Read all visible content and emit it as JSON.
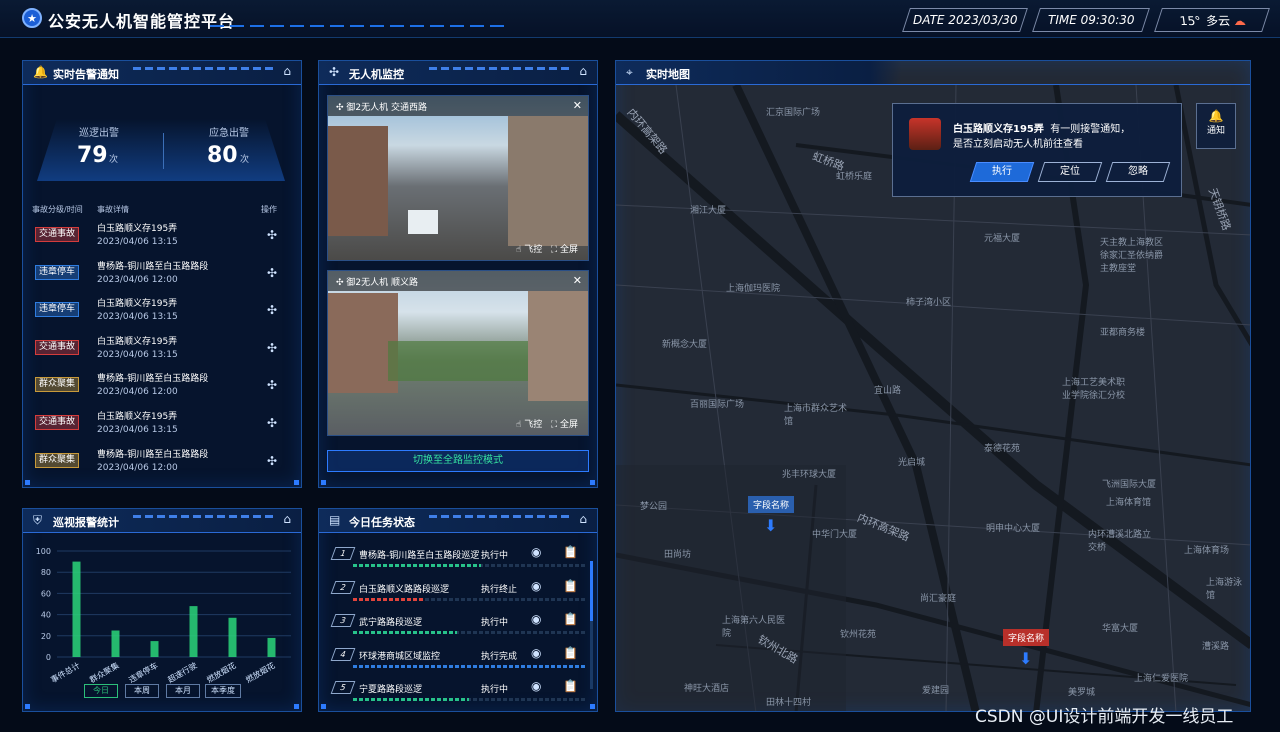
{
  "app": {
    "title": "公安无人机智能管控平台"
  },
  "header": {
    "date": "DATE 2023/03/30",
    "time": "TIME  09:30:30",
    "weather": "15° 多云"
  },
  "alarm_panel": {
    "title": "实时告警通知",
    "patrol_label": "巡逻出警",
    "patrol_count": "79",
    "emergency_label": "应急出警",
    "emergency_count": "80",
    "unit": "次",
    "col_type_time": "事故分级/时间",
    "col_detail": "事故详情",
    "col_action": "操作",
    "rows": [
      {
        "tag": "交通事故",
        "color": "#d43c3c",
        "detail": "白玉路顺义存195弄",
        "time": "2023/04/06 13:15"
      },
      {
        "tag": "违章停车",
        "color": "#2f7de0",
        "detail": "曹杨路-铜川路至白玉路路段",
        "time": "2023/04/06 12:00"
      },
      {
        "tag": "违章停车",
        "color": "#2f7de0",
        "detail": "白玉路顺义存195弄",
        "time": "2023/04/06 13:15"
      },
      {
        "tag": "交通事故",
        "color": "#d43c3c",
        "detail": "白玉路顺义存195弄",
        "time": "2023/04/06 13:15"
      },
      {
        "tag": "群众聚集",
        "color": "#c89a3a",
        "detail": "曹杨路-铜川路至白玉路路段",
        "time": "2023/04/06 12:00"
      },
      {
        "tag": "交通事故",
        "color": "#d43c3c",
        "detail": "白玉路顺义存195弄",
        "time": "2023/04/06 13:15"
      },
      {
        "tag": "群众聚集",
        "color": "#c89a3a",
        "detail": "曹杨路-铜川路至白玉路路段",
        "time": "2023/04/06 12:00"
      }
    ]
  },
  "drone_panel": {
    "title": "无人机监控",
    "cam1": {
      "label": "御2无人机  交通西路",
      "fly": "飞控",
      "full": "全屏"
    },
    "cam2": {
      "label": "御2无人机  顺义路",
      "fly": "飞控",
      "full": "全屏"
    },
    "switch_btn": "切换至全路监控模式"
  },
  "stats_panel": {
    "title": "巡视报警统计",
    "tabs": [
      "今日",
      "本周",
      "本月",
      "本季度"
    ]
  },
  "chart_data": {
    "type": "bar",
    "categories": [
      "事件总计",
      "群众聚集",
      "违章停车",
      "超速行驶",
      "燃放烟花",
      "燃放烟花"
    ],
    "values": [
      90,
      25,
      15,
      48,
      37,
      18
    ],
    "ylim": [
      0,
      100
    ],
    "yticks": [
      "0",
      "20",
      "40",
      "60",
      "80",
      "100"
    ]
  },
  "task_panel": {
    "title": "今日任务状态",
    "tasks": [
      {
        "num": "1",
        "name": "曹杨路-铜川路至白玉路段巡逻",
        "status": "执行中",
        "progress": 0.55,
        "color": "#27c28a"
      },
      {
        "num": "2",
        "name": "白玉路顺义路路段巡逻",
        "status": "执行终止",
        "progress": 0.3,
        "color": "#e0443c"
      },
      {
        "num": "3",
        "name": "武宁路路段巡逻",
        "status": "执行中",
        "progress": 0.45,
        "color": "#27c28a"
      },
      {
        "num": "4",
        "name": "环球港商城区域监控",
        "status": "执行完成",
        "progress": 1.0,
        "color": "#2f7de0"
      },
      {
        "num": "5",
        "name": "宁夏路路段巡逻",
        "status": "执行中",
        "progress": 0.5,
        "color": "#27c28a"
      }
    ]
  },
  "map_panel": {
    "title": "实时地图",
    "notify_label": "通知",
    "popup": {
      "place": "白玉路顺义存195弄",
      "msg1": "有一则接警通知，",
      "msg2": "是否立刻启动无人机前往查看",
      "execute": "执行",
      "locate": "定位",
      "ignore": "忽略"
    },
    "pin1": "字段名称",
    "pin2": "字段名称",
    "places": [
      "汇京国际广场",
      "虹桥乐庭",
      "湘江大厦",
      "上海伽玛医院",
      "新概念大厦",
      "百丽国际广场",
      "上海市群众艺术馆",
      "兆丰环球大厦",
      "光启城",
      "梦公园",
      "田尚坊",
      "中华门大厦",
      "上海第六人民医院",
      "钦州花苑",
      "尚汇豪庭",
      "神旺大酒店",
      "田林十四村",
      "爱建园",
      "元福大厦",
      "天主教上海教区徐家汇圣依纳爵主教座堂",
      "柿子湾小区",
      "亚都商务楼",
      "上海工艺美术职业学院徐汇分校",
      "泰德花苑",
      "明申中心大厦",
      "飞洲国际大厦",
      "上海体育馆",
      "上海体育场",
      "内环漕溪北路立交桥",
      "上海游泳馆",
      "华富大厦",
      "漕溪路",
      "上海仁爱医院",
      "美罗城",
      "宜山路"
    ],
    "roads": [
      "内环高架路",
      "虹桥路",
      "钦州北路",
      "内环高架路",
      "天钥桥路"
    ]
  },
  "watermark": "CSDN @UI设计前端开发一线员工"
}
